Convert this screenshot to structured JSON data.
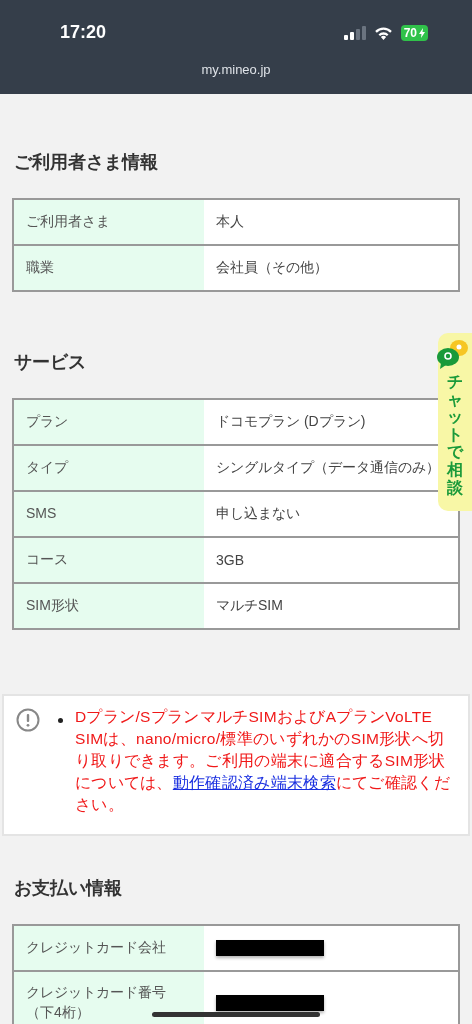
{
  "status_bar": {
    "time": "17:20",
    "battery": "70",
    "charging": true,
    "url": "my.mineo.jp"
  },
  "sections": [
    {
      "kind": "table",
      "title": "ご利用者さま情報",
      "rows": [
        {
          "label": "ご利用者さま",
          "value": "本人"
        },
        {
          "label": "職業",
          "value": "会社員（その他）"
        }
      ]
    },
    {
      "kind": "table",
      "title": "サービス",
      "rows": [
        {
          "label": "プラン",
          "value": "ドコモプラン (Dプラン)"
        },
        {
          "label": "タイプ",
          "value": "シングルタイプ（データ通信のみ）"
        },
        {
          "label": "SMS",
          "value": "申し込まない"
        },
        {
          "label": "コース",
          "value": "3GB"
        },
        {
          "label": "SIM形状",
          "value": "マルチSIM"
        }
      ]
    },
    {
      "kind": "notice",
      "text_before": "Dプラン/SプランマルチSIMおよびAプランVoLTE SIMは、nano/micro/標準のいずれかのSIM形状へ切り取りできます。ご利用の端末に適合するSIM形状については、",
      "link": "動作確認済み端末検索",
      "text_after": "にてご確認ください。"
    },
    {
      "kind": "table",
      "title": "お支払い情報",
      "rows": [
        {
          "label": "クレジットカード会社",
          "redacted": true
        },
        {
          "label": "クレジットカード番号（下4桁）",
          "redacted": true
        }
      ]
    }
  ],
  "chat_tab": {
    "label": "チャットで相談"
  }
}
